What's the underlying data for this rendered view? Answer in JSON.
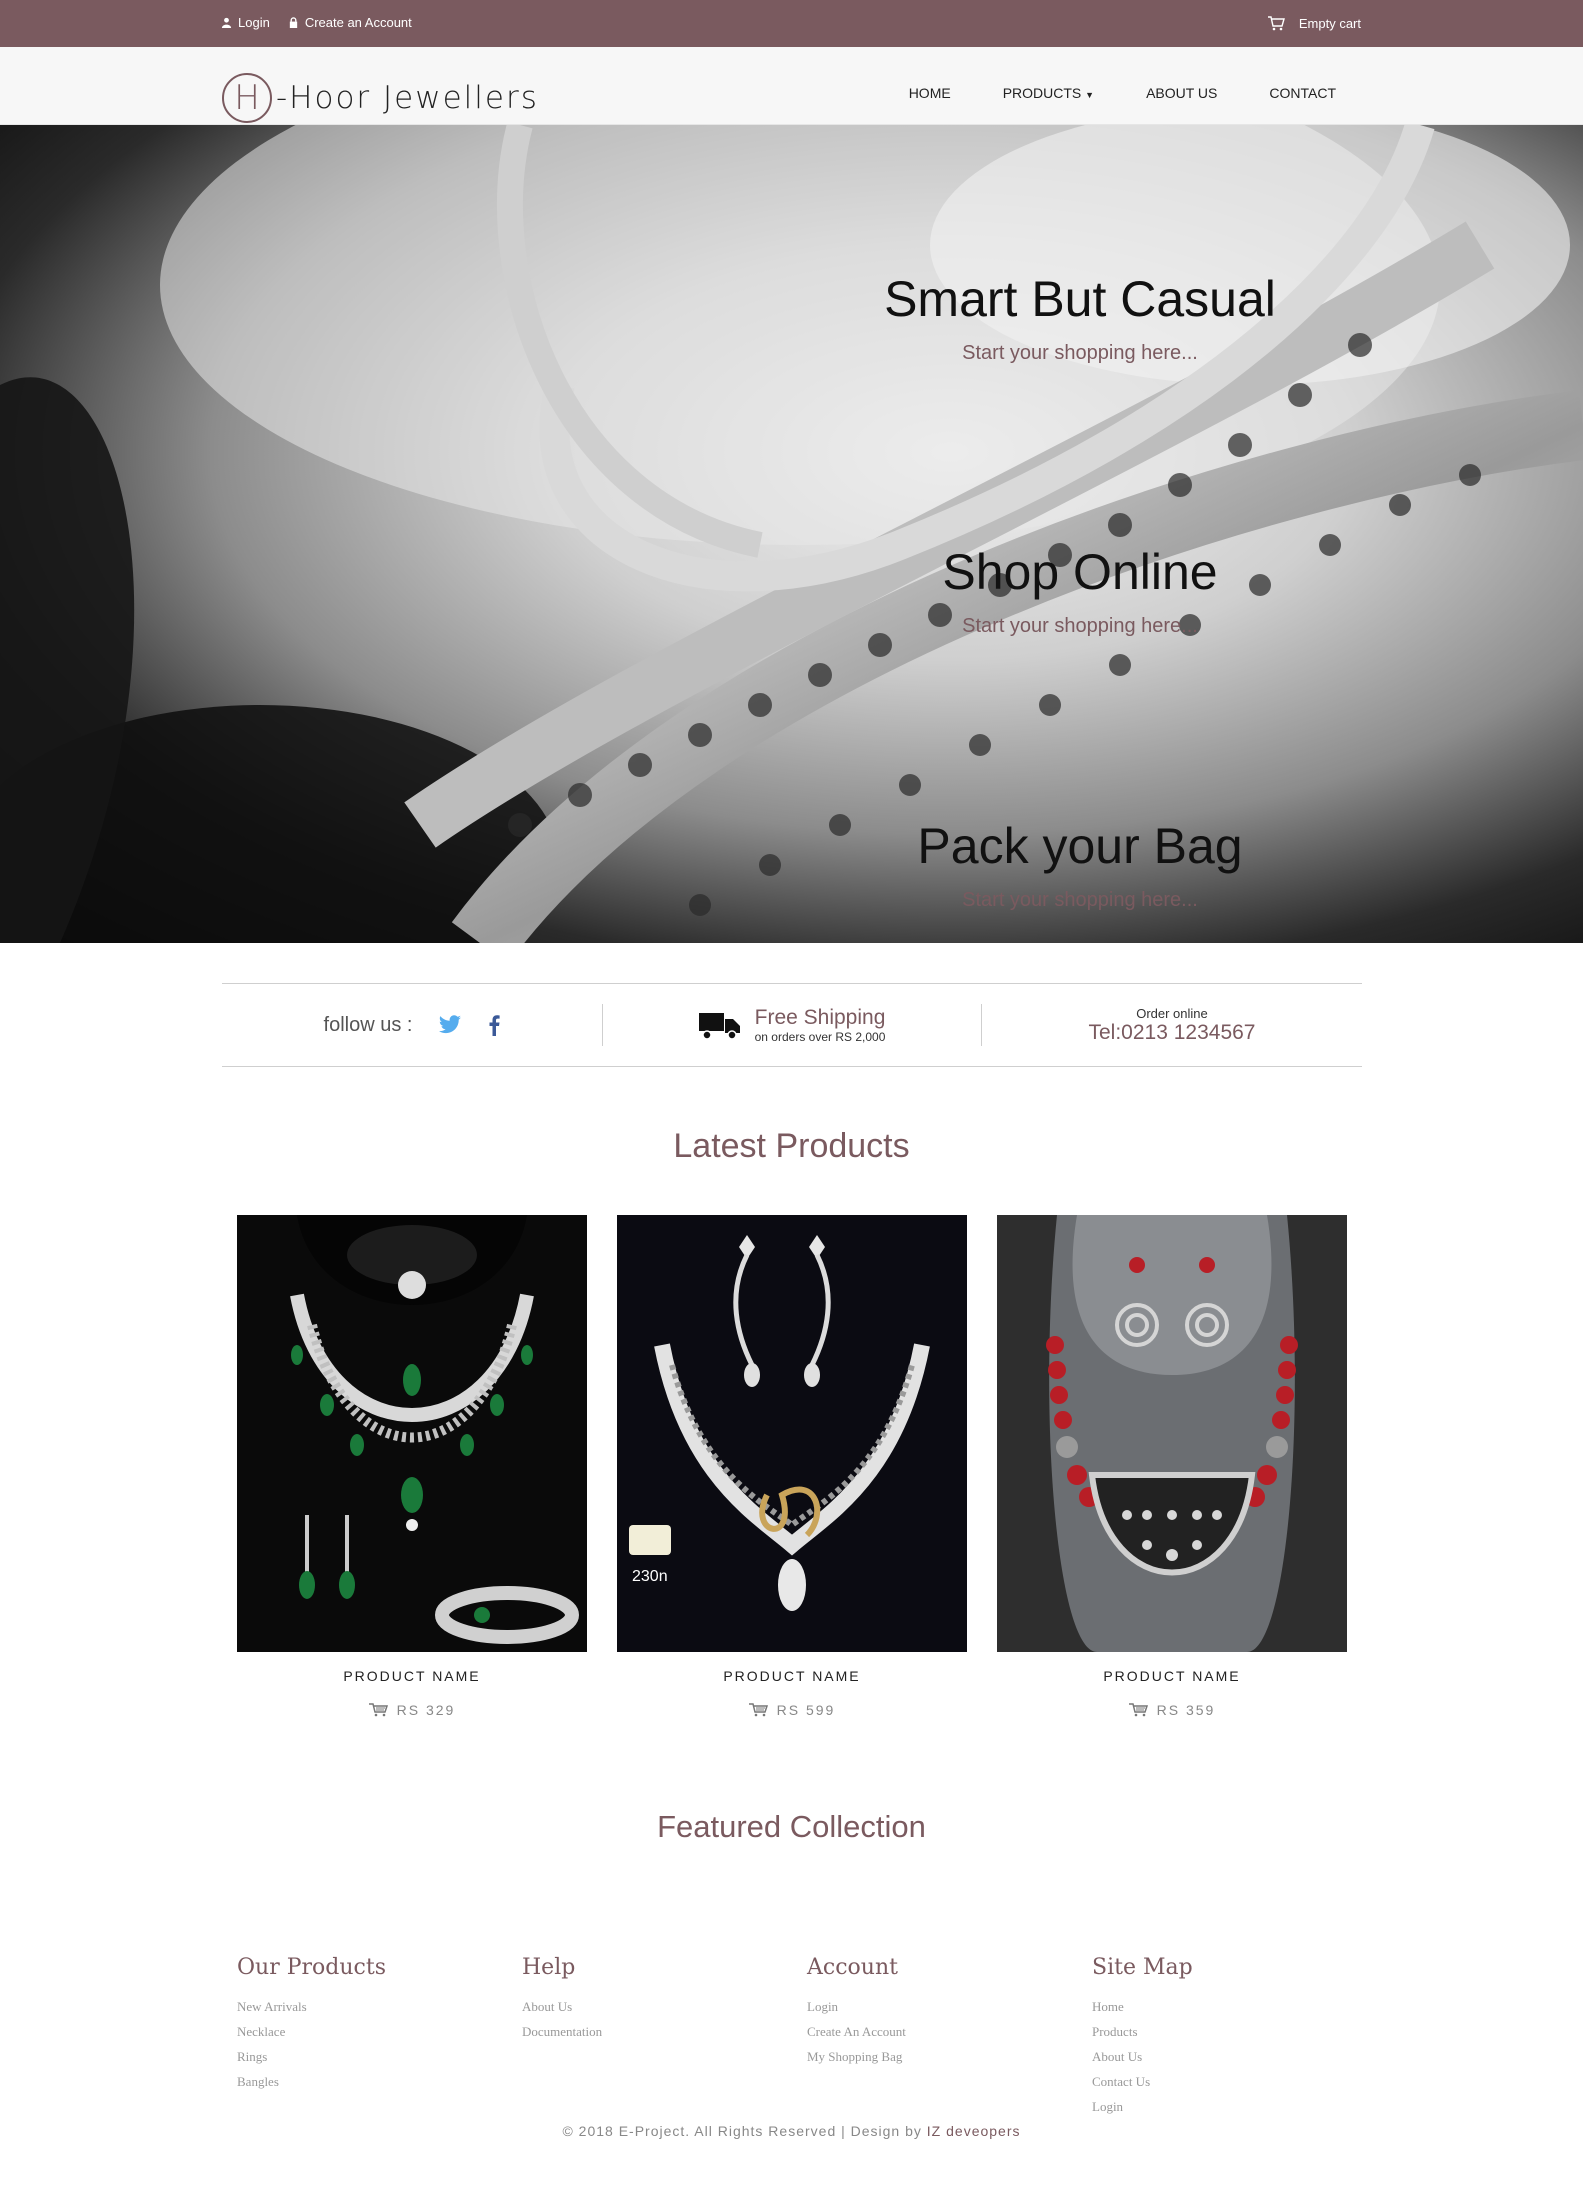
{
  "topbar": {
    "login": "Login",
    "create_account": "Create an Account",
    "cart": "Empty cart"
  },
  "header": {
    "logo_letter": "H",
    "logo_text": "-Hoor Jewellers",
    "nav": [
      "HOME",
      "PRODUCTS",
      "ABOUT US",
      "CONTACT"
    ]
  },
  "hero": {
    "slides": [
      {
        "title": "Smart But Casual",
        "subtitle": "Start your shopping here..."
      },
      {
        "title": "Shop Online",
        "subtitle": "Start your shopping here..."
      },
      {
        "title": "Pack your Bag",
        "subtitle": "Start your shopping here..."
      }
    ]
  },
  "info": {
    "follow_label": "follow us :",
    "shipping_title": "Free Shipping",
    "shipping_sub": "on orders over RS 2,000",
    "order_label": "Order online",
    "order_tel": "Tel:0213 1234567"
  },
  "latest": {
    "title": "Latest Products",
    "products": [
      {
        "name": "PRODUCT NAME",
        "price": "RS 329"
      },
      {
        "name": "PRODUCT NAME",
        "price": "RS 599"
      },
      {
        "name": "PRODUCT NAME",
        "price": "RS 359"
      }
    ]
  },
  "featured": {
    "title": "Featured Collection"
  },
  "footer": {
    "columns": [
      {
        "title": "Our Products",
        "links": [
          "New Arrivals",
          "Necklace",
          "Rings",
          "Bangles"
        ]
      },
      {
        "title": "Help",
        "links": [
          "About Us",
          "Documentation"
        ]
      },
      {
        "title": "Account",
        "links": [
          "Login",
          "Create An Account",
          "My Shopping Bag"
        ]
      },
      {
        "title": "Site Map",
        "links": [
          "Home",
          "Products",
          "About Us",
          "Contact Us",
          "Login"
        ]
      }
    ],
    "copyright": "© 2018 E-Project. All Rights Reserved | Design by",
    "brand": "IZ deveopers"
  },
  "colors": {
    "accent": "#7a5a5f",
    "twitter": "#55acee",
    "facebook": "#3b5998"
  },
  "icons": [
    "user-icon",
    "lock-icon",
    "cart-icon",
    "twitter-icon",
    "facebook-icon",
    "truck-icon",
    "price-cart-icon"
  ]
}
